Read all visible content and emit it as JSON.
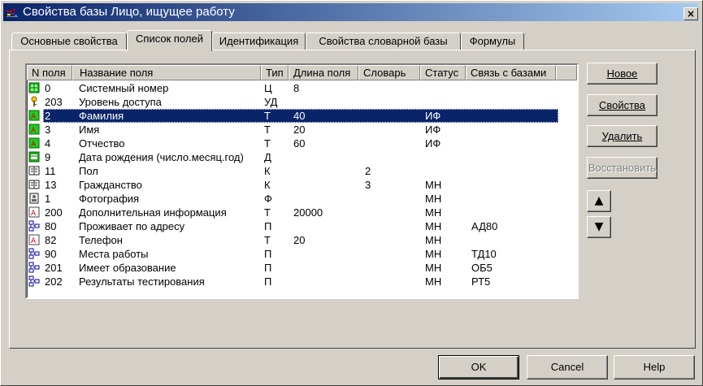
{
  "window": {
    "title": "Свойства базы Лицо, ищущее работу",
    "close_glyph": "×"
  },
  "tabs": [
    {
      "label": "Основные свойства"
    },
    {
      "label": "Список полей"
    },
    {
      "label": "Идентификация"
    },
    {
      "label": "Свойства словарной базы"
    },
    {
      "label": "Формулы"
    }
  ],
  "active_tab": "Список полей",
  "columns": [
    {
      "label": "N поля"
    },
    {
      "label": "Название поля"
    },
    {
      "label": "Тип"
    },
    {
      "label": "Длина поля"
    },
    {
      "label": "Словарь"
    },
    {
      "label": "Статус"
    },
    {
      "label": "Связь с базами"
    }
  ],
  "rows": [
    {
      "icon": "green-grid-icon",
      "n": "0",
      "name": "Системный номер",
      "type": "Ц",
      "len": "8",
      "dict": "",
      "status": "",
      "link": ""
    },
    {
      "icon": "key-icon",
      "n": "203",
      "name": "Уровень доступа",
      "type": "УД",
      "len": "",
      "dict": "",
      "status": "",
      "link": ""
    },
    {
      "icon": "text-field-icon",
      "n": "2",
      "name": "Фамилия",
      "type": "Т",
      "len": "40",
      "dict": "",
      "status": "ИФ",
      "link": ""
    },
    {
      "icon": "text-field-icon",
      "n": "3",
      "name": "Имя",
      "type": "Т",
      "len": "20",
      "dict": "",
      "status": "ИФ",
      "link": ""
    },
    {
      "icon": "text-field-icon",
      "n": "4",
      "name": "Отчество",
      "type": "Т",
      "len": "60",
      "dict": "",
      "status": "ИФ",
      "link": ""
    },
    {
      "icon": "date-field-icon",
      "n": "9",
      "name": "Дата рождения (число.месяц.год)",
      "type": "Д",
      "len": "",
      "dict": "",
      "status": "",
      "link": ""
    },
    {
      "icon": "dictionary-icon",
      "n": "11",
      "name": "Пол",
      "type": "К",
      "len": "",
      "dict": "2",
      "status": "",
      "link": ""
    },
    {
      "icon": "dictionary-icon",
      "n": "13",
      "name": "Гражданство",
      "type": "К",
      "len": "",
      "dict": "3",
      "status": "МН",
      "link": ""
    },
    {
      "icon": "photo-icon",
      "n": "1",
      "name": "Фотография",
      "type": "Ф",
      "len": "",
      "dict": "",
      "status": "МН",
      "link": ""
    },
    {
      "icon": "text-red-icon",
      "n": "200",
      "name": "Дополнительная информация",
      "type": "Т",
      "len": "20000",
      "dict": "",
      "status": "МН",
      "link": ""
    },
    {
      "icon": "link-icon",
      "n": "80",
      "name": "Проживает по адресу",
      "type": "П",
      "len": "",
      "dict": "",
      "status": "МН",
      "link": "АД80"
    },
    {
      "icon": "text-red-icon",
      "n": "82",
      "name": "Телефон",
      "type": "Т",
      "len": "20",
      "dict": "",
      "status": "МН",
      "link": ""
    },
    {
      "icon": "link-icon",
      "n": "90",
      "name": "Места работы",
      "type": "П",
      "len": "",
      "dict": "",
      "status": "МН",
      "link": "ТД10"
    },
    {
      "icon": "link-icon",
      "n": "201",
      "name": "Имеет образование",
      "type": "П",
      "len": "",
      "dict": "",
      "status": "МН",
      "link": "ОБ5"
    },
    {
      "icon": "link-icon",
      "n": "202",
      "name": "Результаты тестирования",
      "type": "П",
      "len": "",
      "dict": "",
      "status": "МН",
      "link": "РТ5"
    }
  ],
  "selected_row": "2",
  "side_buttons": {
    "new": "Новое",
    "properties": "Свойства",
    "delete": "Удалить",
    "restore": "Восстановить",
    "up": "▲",
    "down": "▼"
  },
  "footer": {
    "ok": "OK",
    "cancel": "Cancel",
    "help": "Help"
  }
}
